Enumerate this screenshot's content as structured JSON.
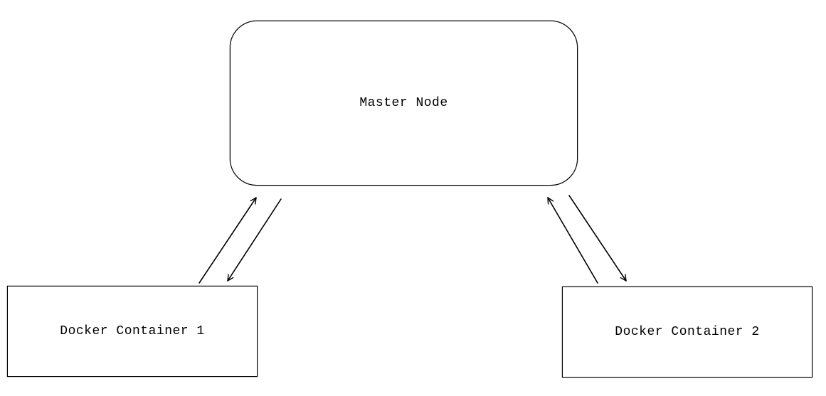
{
  "nodes": {
    "master": {
      "label": "Master Node"
    },
    "container1": {
      "label": "Docker Container 1"
    },
    "container2": {
      "label": "Docker Container 2"
    }
  },
  "edges": [
    {
      "from": "container1",
      "to": "master",
      "bidirectional": true
    },
    {
      "from": "master",
      "to": "container2",
      "bidirectional": true
    }
  ]
}
